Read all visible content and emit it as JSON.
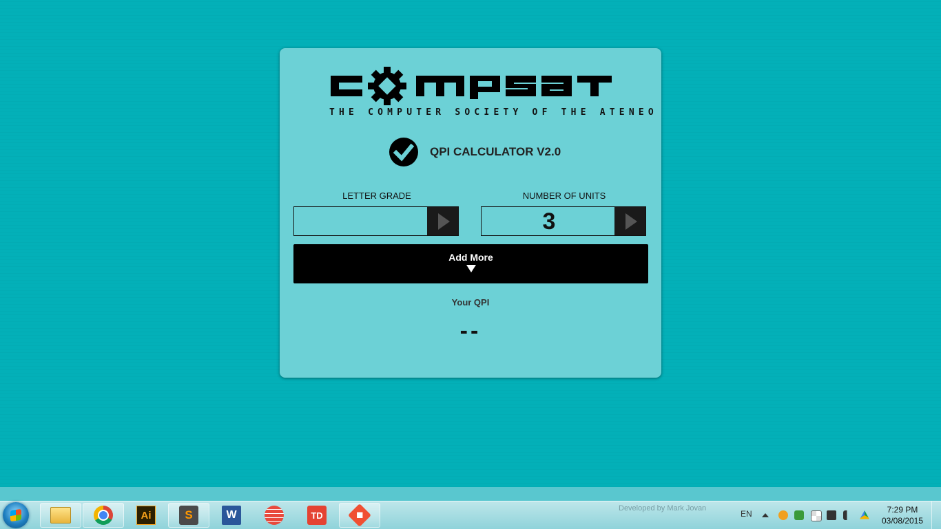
{
  "app": {
    "logo_text": "COMPSAT",
    "logo_subtitle": "THE COMPUTER SOCIETY OF THE ATENEO",
    "title": "QPI CALCULATOR V2.0",
    "letter_grade": {
      "label": "LETTER GRADE",
      "value": ""
    },
    "units": {
      "label": "NUMBER OF UNITS",
      "value": "3"
    },
    "add_more_label": "Add More",
    "qpi_label": "Your QPI",
    "qpi_value": "--"
  },
  "taskbar": {
    "apps": [
      {
        "name": "file-explorer",
        "icon": "folder-icon"
      },
      {
        "name": "chrome",
        "icon": "chrome-icon"
      },
      {
        "name": "illustrator",
        "icon": "illustrator-icon",
        "glyph": "Ai"
      },
      {
        "name": "sublime-text",
        "icon": "sublime-icon",
        "glyph": "S"
      },
      {
        "name": "word",
        "icon": "word-icon",
        "glyph": "W"
      },
      {
        "name": "app-red-circle",
        "icon": "sunrise-icon"
      },
      {
        "name": "todoist",
        "icon": "todoist-icon",
        "glyph": "TD"
      },
      {
        "name": "git",
        "icon": "git-icon",
        "glyph": "⬥"
      }
    ],
    "watermark": "Developed by Mark Jovan",
    "language": "EN",
    "time": "7:29 PM",
    "date": "03/08/2015"
  },
  "colors": {
    "background": "#03b0b8",
    "card": "#6cd1d6",
    "button": "#000000",
    "illustrator": "#2b1f00",
    "sublime": "#4a4a4a",
    "word": "#2b579a",
    "todoist": "#e44332",
    "git": "#f05033"
  }
}
